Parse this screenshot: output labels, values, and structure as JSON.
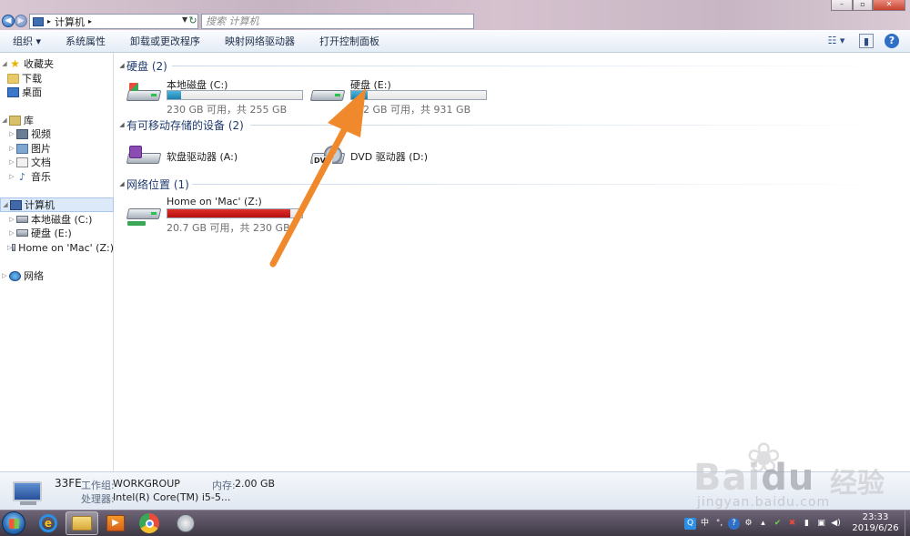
{
  "window": {
    "address_crumb": "计算机",
    "search_placeholder": "搜索 计算机",
    "controls": [
      "–",
      "▫",
      "✕"
    ]
  },
  "toolbar": {
    "organize": "组织 ▾",
    "system_properties": "系统属性",
    "uninstall": "卸载或更改程序",
    "map_drive": "映射网络驱动器",
    "control_panel": "打开控制面板"
  },
  "sidebar": {
    "favorites": "收藏夹",
    "downloads": "下载",
    "desktop": "桌面",
    "libraries": "库",
    "videos": "视频",
    "pictures": "图片",
    "documents": "文档",
    "music": "音乐",
    "computer": "计算机",
    "local_disk_c": "本地磁盘 (C:)",
    "disk_e": "硬盘 (E:)",
    "home_mac": "Home on 'Mac' (Z:)",
    "network": "网络"
  },
  "groups": {
    "hard_disks": "硬盘 (2)",
    "removable": "有可移动存储的设备 (2)",
    "network": "网络位置 (1)"
  },
  "drives": {
    "c": {
      "name": "本地磁盘 (C:)",
      "info": "230 GB 可用，共 255 GB",
      "used_fraction": 0.1
    },
    "e": {
      "name": "硬盘 (E:)",
      "info": "822 GB 可用，共 931 GB",
      "used_fraction": 0.12
    },
    "a": {
      "name": "软盘驱动器 (A:)"
    },
    "d": {
      "name": "DVD 驱动器 (D:)",
      "badge": "DVD"
    },
    "z": {
      "name": "Home on 'Mac' (Z:)",
      "info": "20.7 GB 可用，共 230 GB",
      "used_fraction": 0.91
    }
  },
  "details": {
    "pc_name": "33FE",
    "workgroup_label": "工作组:",
    "workgroup_value": "WORKGROUP",
    "memory_label": "内存:",
    "memory_value": "2.00 GB",
    "cpu_label": "处理器:",
    "cpu_value": "Intel(R) Core(TM) i5-5..."
  },
  "taskbar": {
    "clock_time": "23:33",
    "clock_date": "2019/6/26",
    "tray_lang": "中"
  },
  "watermark": {
    "brand": "Bai",
    "brand2": "du",
    "cn": "经验",
    "url": "jingyan.baidu.com"
  },
  "colors": {
    "bar_blue": "#1f7fae",
    "bar_red": "#c4151a",
    "arrow": "#f0892c",
    "header_text": "#1e3b6e"
  }
}
